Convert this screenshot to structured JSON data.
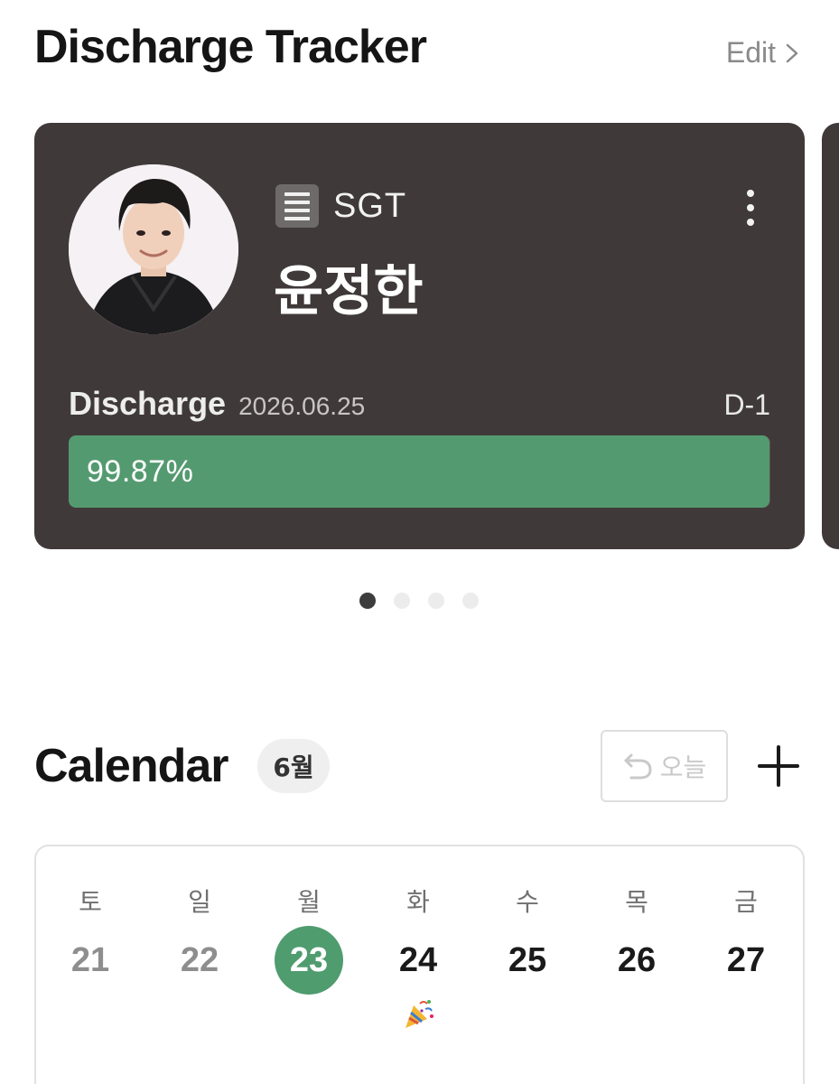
{
  "header": {
    "title": "Discharge Tracker",
    "edit_label": "Edit"
  },
  "card": {
    "unit": "SGT",
    "name": "윤정한",
    "discharge_label": "Discharge",
    "discharge_date": "2026.06.25",
    "dday": "D-1",
    "progress_text": "99.87%",
    "progress_value": 99.87
  },
  "carousel": {
    "page_count": 4,
    "active_index": 0
  },
  "calendar": {
    "title": "Calendar",
    "month_badge": "6월",
    "today_label": "오늘",
    "days": [
      {
        "weekday": "토",
        "date": "21",
        "state": "past"
      },
      {
        "weekday": "일",
        "date": "22",
        "state": "past"
      },
      {
        "weekday": "월",
        "date": "23",
        "state": "today"
      },
      {
        "weekday": "화",
        "date": "24",
        "state": "future",
        "event_icon": "party-popper-icon"
      },
      {
        "weekday": "수",
        "date": "25",
        "state": "future"
      },
      {
        "weekday": "목",
        "date": "26",
        "state": "future"
      },
      {
        "weekday": "금",
        "date": "27",
        "state": "future"
      }
    ]
  },
  "colors": {
    "card_bg": "#403939",
    "progress_green": "#549a70",
    "today_green": "#4f9c6f"
  }
}
